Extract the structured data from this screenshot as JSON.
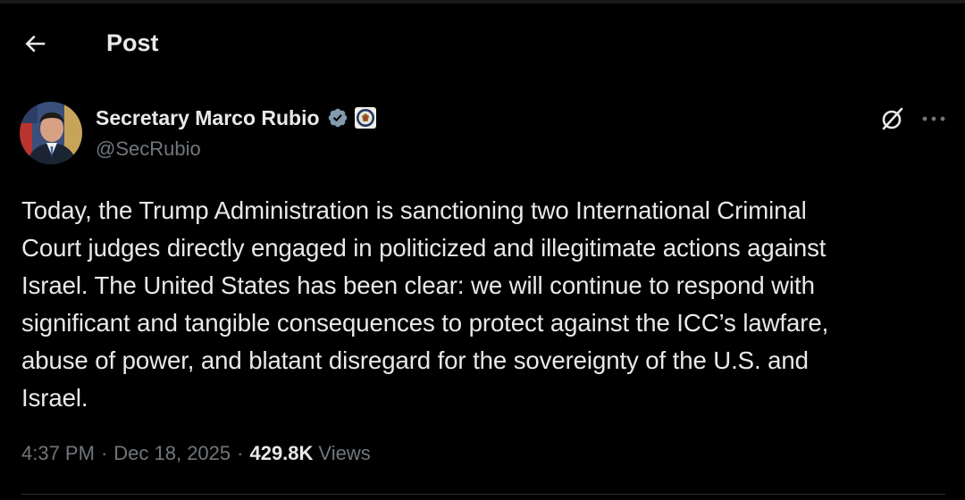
{
  "header": {
    "title": "Post",
    "back_icon": "arrow-left-icon"
  },
  "author": {
    "name": "Secretary Marco Rubio",
    "handle": "@SecRubio",
    "verified": true,
    "verified_color": "#829aab",
    "affiliate_badge": "department-of-state-seal-icon"
  },
  "actions": {
    "grok_icon": "grok-icon",
    "more_icon": "more-horizontal-icon"
  },
  "post": {
    "lines": [
      "Today, the Trump Administration is sanctioning two International Criminal",
      "Court judges directly engaged in politicized and illegitimate actions against",
      "Israel. The United States has been clear: we will continue to respond with",
      "significant and tangible consequences to protect against the ICC’s lawfare,",
      "abuse of power, and blatant disregard for the sovereignty of the U.S. and",
      "Israel."
    ]
  },
  "meta": {
    "time": "4:37 PM",
    "separator": "·",
    "date": "Dec 18, 2025",
    "views_count": "429.8K",
    "views_label": "Views"
  },
  "colors": {
    "background": "#000000",
    "text_primary": "#e7e9ea",
    "text_secondary": "#71767b",
    "divider": "#2f3336"
  }
}
